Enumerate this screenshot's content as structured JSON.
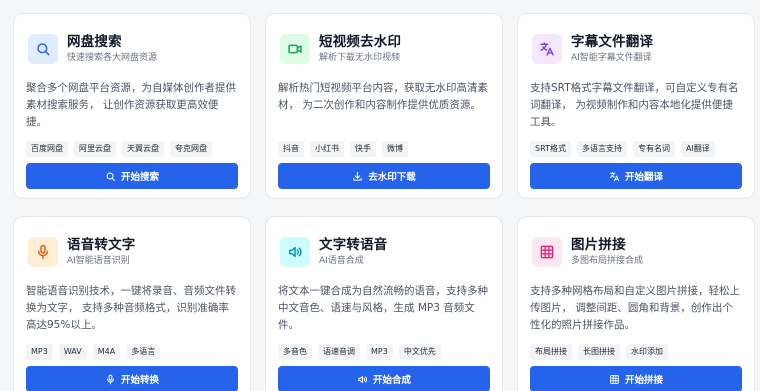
{
  "cards": [
    {
      "title": "网盘搜索",
      "subtitle": "快速搜索各大网盘资源",
      "icon": "search-icon",
      "icon_color": "#2563eb",
      "icon_bg": "#e0ecff",
      "description": "聚合多个网盘平台资源，为自媒体创作者提供素材搜索服务， 让创作资源获取更高效便捷。",
      "tags": [
        "百度网盘",
        "阿里云盘",
        "天翼云盘",
        "夸克网盘"
      ],
      "button_label": "开始搜索",
      "button_icon": "search-icon"
    },
    {
      "title": "短视频去水印",
      "subtitle": "解析下载无水印视频",
      "icon": "video-icon",
      "icon_color": "#16a34a",
      "icon_bg": "#dcfce7",
      "description": "解析热门短视频平台内容，获取无水印高清素材， 为二次创作和内容制作提供优质资源。",
      "tags": [
        "抖音",
        "小红书",
        "快手",
        "微博"
      ],
      "button_label": "去水印下载",
      "button_icon": "download-icon"
    },
    {
      "title": "字幕文件翻译",
      "subtitle": "AI智能字幕文件翻译",
      "icon": "translate-icon",
      "icon_color": "#7c3aed",
      "icon_bg": "#f3e8ff",
      "description": "支持SRT格式字幕文件翻译，可自定义专有名词翻译， 为视频制作和内容本地化提供便捷工具。",
      "tags": [
        "SRT格式",
        "多语言支持",
        "专有名词",
        "AI翻译"
      ],
      "button_label": "开始翻译",
      "button_icon": "translate-icon"
    },
    {
      "title": "语音转文字",
      "subtitle": "AI智能语音识别",
      "icon": "microphone-icon",
      "icon_color": "#ea580c",
      "icon_bg": "#ffedd5",
      "description": "智能语音识别技术，一键将录音、音频文件转换为文字， 支持多种音频格式，识别准确率高达95%以上。",
      "tags": [
        "MP3",
        "WAV",
        "M4A",
        "多语言"
      ],
      "button_label": "开始转换",
      "button_icon": "microphone-icon"
    },
    {
      "title": "文字转语音",
      "subtitle": "AI语音合成",
      "icon": "speaker-icon",
      "icon_color": "#0891b2",
      "icon_bg": "#cffafe",
      "description": "将文本一键合成为自然流畅的语音，支持多种中文音色、语速与风格，生成 MP3 音频文件。",
      "tags": [
        "多音色",
        "语速音调",
        "MP3",
        "中文优先"
      ],
      "button_label": "开始合成",
      "button_icon": "speaker-icon"
    },
    {
      "title": "图片拼接",
      "subtitle": "多图布局拼接合成",
      "icon": "grid-icon",
      "icon_color": "#db2777",
      "icon_bg": "#fce7f3",
      "description": "支持多种网格布局和自定义图片拼接，轻松上传图片， 调整间距、圆角和背景，创作出个性化的照片拼接作品。",
      "tags": [
        "布局拼接",
        "长图拼接",
        "水印添加"
      ],
      "button_label": "开始拼接",
      "button_icon": "grid-icon"
    }
  ]
}
